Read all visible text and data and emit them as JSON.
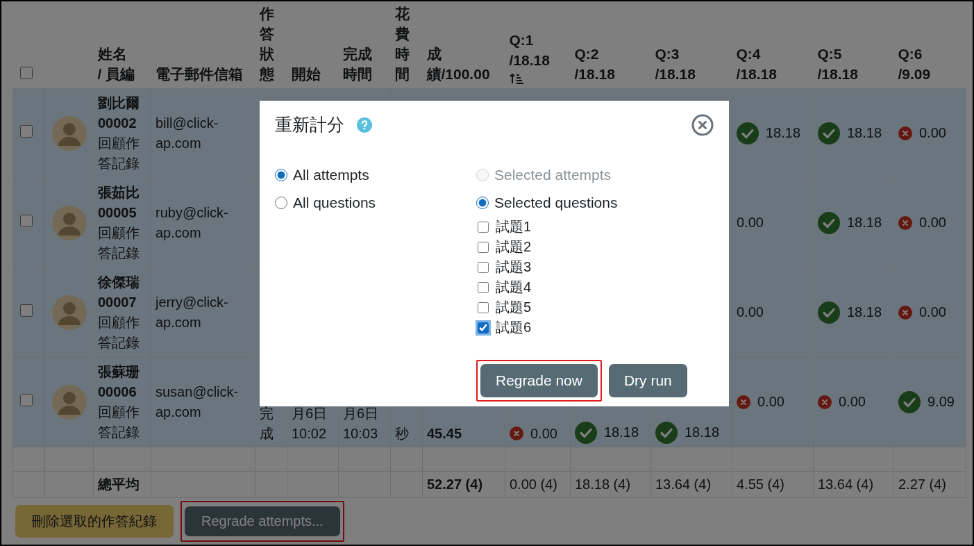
{
  "table": {
    "select_all": {
      "checked": false
    },
    "columns": [
      {
        "label": "姓名\n/ 員編",
        "sorted": false
      },
      {
        "label": "電子郵件信箱",
        "sorted": false
      },
      {
        "label": "作答狀態",
        "sorted": false
      },
      {
        "label": "開始",
        "sorted": false
      },
      {
        "label": "完成時間",
        "sorted": false
      },
      {
        "label": "花費時間",
        "sorted": false
      },
      {
        "label": "成績/100.00",
        "sorted": false
      },
      {
        "label": "Q:1\n/18.18",
        "sorted": true
      },
      {
        "label": "Q:2\n/18.18",
        "sorted": false
      },
      {
        "label": "Q:3\n/18.18",
        "sorted": false
      },
      {
        "label": "Q:4\n/18.18",
        "sorted": false
      },
      {
        "label": "Q:5\n/18.18",
        "sorted": false
      },
      {
        "label": "Q:6\n/9.09",
        "sorted": false
      }
    ],
    "rows": [
      {
        "selected": false,
        "name": "劉比爾",
        "id": "00002",
        "review_link": "回顧作答記錄",
        "email": "bill@click-ap.com",
        "answers": [
          {
            "value": "18.18",
            "correct": true
          },
          {
            "value": "18.18",
            "correct": true
          },
          {
            "value": "0.00",
            "correct": false
          }
        ]
      },
      {
        "selected": false,
        "name": "張茹比",
        "id": "00005",
        "review_link": "回顧作答記錄",
        "email": "ruby@click-ap.com",
        "answers": [
          {
            "value": "0.00"
          },
          {
            "value": "18.18",
            "correct": true
          },
          {
            "value": "0.00",
            "correct": false
          }
        ]
      },
      {
        "selected": false,
        "name": "徐傑瑞",
        "id": "00007",
        "review_link": "回顧作答記錄",
        "email": "jerry@click-ap.com",
        "answers": [
          {
            "value": "0.00"
          },
          {
            "value": "18.18",
            "correct": true
          },
          {
            "value": "0.00",
            "correct": false
          }
        ]
      },
      {
        "selected": false,
        "name": "張蘇珊",
        "id": "00006",
        "review_link": "回顧作答記錄",
        "email": "susan@click-ap.com",
        "status": "完成",
        "started": "月6日 10:02",
        "completed": "月6日 10:03",
        "duration": "秒",
        "grade": "45.45",
        "answers": [
          {
            "value": "0.00",
            "correct": false
          },
          {
            "value": "18.18",
            "correct": true
          },
          {
            "value": "18.18",
            "correct": true
          },
          {
            "value": "0.00",
            "correct": false
          },
          {
            "value": "0.00",
            "correct": false
          },
          {
            "value": "9.09",
            "correct": true
          }
        ]
      }
    ],
    "average": {
      "label": "總平均",
      "grade": "52.27 (4)",
      "answers": [
        "0.00 (4)",
        "18.18 (4)",
        "13.64 (4)",
        "4.55 (4)",
        "13.64 (4)",
        "2.27 (4)"
      ]
    }
  },
  "actions": [
    {
      "label": "刪除選取的作答紀錄",
      "kind": "warning",
      "highlighted": false
    },
    {
      "label": "Regrade attempts...",
      "kind": "secondary",
      "highlighted": true
    }
  ],
  "modal": {
    "title": "重新計分",
    "attempt_options": [
      {
        "label": "All attempts",
        "selected": true,
        "disabled": false
      },
      {
        "label": "Selected attempts",
        "selected": false,
        "disabled": true
      }
    ],
    "question_options": [
      {
        "label": "All questions",
        "selected": false,
        "disabled": false
      },
      {
        "label": "Selected questions",
        "selected": true,
        "disabled": false
      }
    ],
    "questions": [
      {
        "label": "試題1",
        "checked": false
      },
      {
        "label": "試題2",
        "checked": false
      },
      {
        "label": "試題3",
        "checked": false
      },
      {
        "label": "試題4",
        "checked": false
      },
      {
        "label": "試題5",
        "checked": false
      },
      {
        "label": "試題6",
        "checked": true
      }
    ],
    "buttons": [
      {
        "label": "Regrade now",
        "highlighted": true
      },
      {
        "label": "Dry run",
        "highlighted": false
      }
    ]
  }
}
